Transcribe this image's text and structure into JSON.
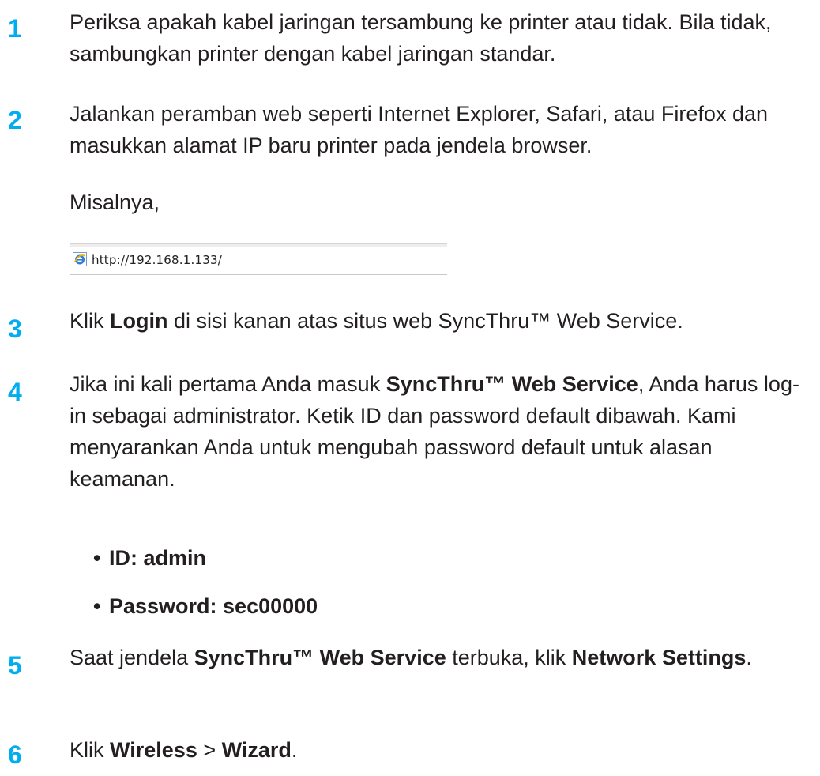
{
  "steps": [
    {
      "number": "1",
      "text": "Periksa apakah kabel jaringan tersambung ke printer atau tidak. Bila tidak, sambungkan printer dengan kabel jaringan standar."
    },
    {
      "number": "2",
      "text": "Jalankan peramban web seperti Internet Explorer, Safari, atau Firefox dan masukkan alamat IP baru printer pada jendela browser.",
      "example_label": "Misalnya,"
    },
    {
      "number": "3",
      "pre": "Klik ",
      "bold": "Login",
      "post": " di sisi kanan atas situs web SyncThru™ Web Service."
    },
    {
      "number": "4",
      "pre": "Jika ini kali pertama Anda masuk ",
      "bold": "SyncThru™ Web Service",
      "post": ", Anda harus log-in sebagai administrator. Ketik ID dan password default dibawah. Kami menyarankan Anda untuk mengubah password default untuk alasan keamanan."
    },
    {
      "number": "5",
      "pre": "Saat jendela ",
      "bold": "SyncThru™ Web Service",
      "mid": " terbuka, klik ",
      "bold2": "Network Settings",
      "post": "."
    },
    {
      "number": "6",
      "pre": "Klik ",
      "bold": "Wireless",
      "mid": " > ",
      "bold2": "Wizard",
      "post": "."
    }
  ],
  "credentials": [
    {
      "bullet": "•",
      "text": "ID: admin"
    },
    {
      "bullet": "•",
      "text": "Password: sec00000"
    }
  ],
  "address_bar": {
    "url": "http://192.168.1.133/",
    "icon": "ie-browser-icon"
  },
  "colors": {
    "step_number": "#00aeef",
    "text": "#231f20"
  }
}
